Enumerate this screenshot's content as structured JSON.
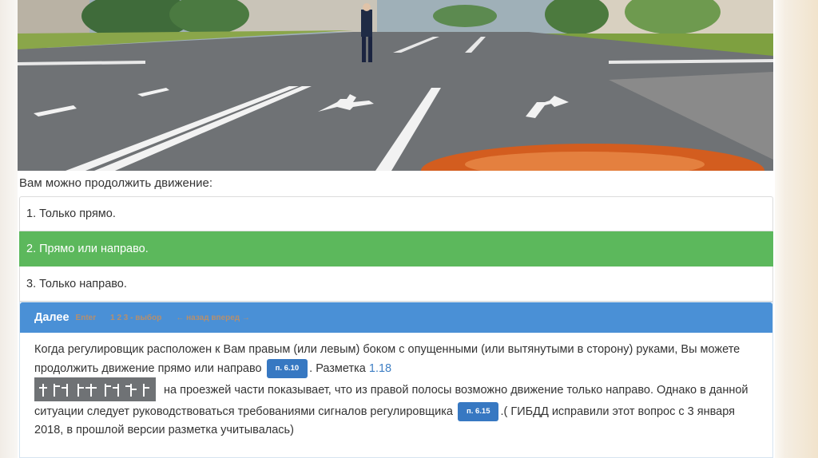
{
  "question": "Вам можно продолжить движение:",
  "answers": [
    {
      "label": "1. Только прямо."
    },
    {
      "label": "2. Прямо или направо."
    },
    {
      "label": "3. Только направо."
    }
  ],
  "panel": {
    "next_label": "Далее",
    "hints": [
      "Enter",
      "1 2 3 - выбор",
      "← назад  вперед →"
    ],
    "explanation": {
      "part1": "Когда регулировщик расположен к Вам правым (или левым) боком с опущенными (или вытянутыми в сторону) руками, Вы можете продолжить движение прямо или направо",
      "ref1": "п. 6.10",
      "part2": ". Разметка",
      "marking_link": "1.18",
      "part3": "на проезжей части показывает, что из правой полосы возможно движение только направо. Однако в данной ситуации следует руководствоваться требованиями сигналов регулировщика",
      "ref2": "п. 6.15",
      "part4": ".( ГИБДД исправили этот вопрос с 3 января 2018, в прошлой версии разметка учитывалась)"
    }
  },
  "colors": {
    "correct": "#5cb85c",
    "panel_header": "#4a90d6",
    "badge": "#3778c2",
    "link": "#3f7fc4"
  }
}
